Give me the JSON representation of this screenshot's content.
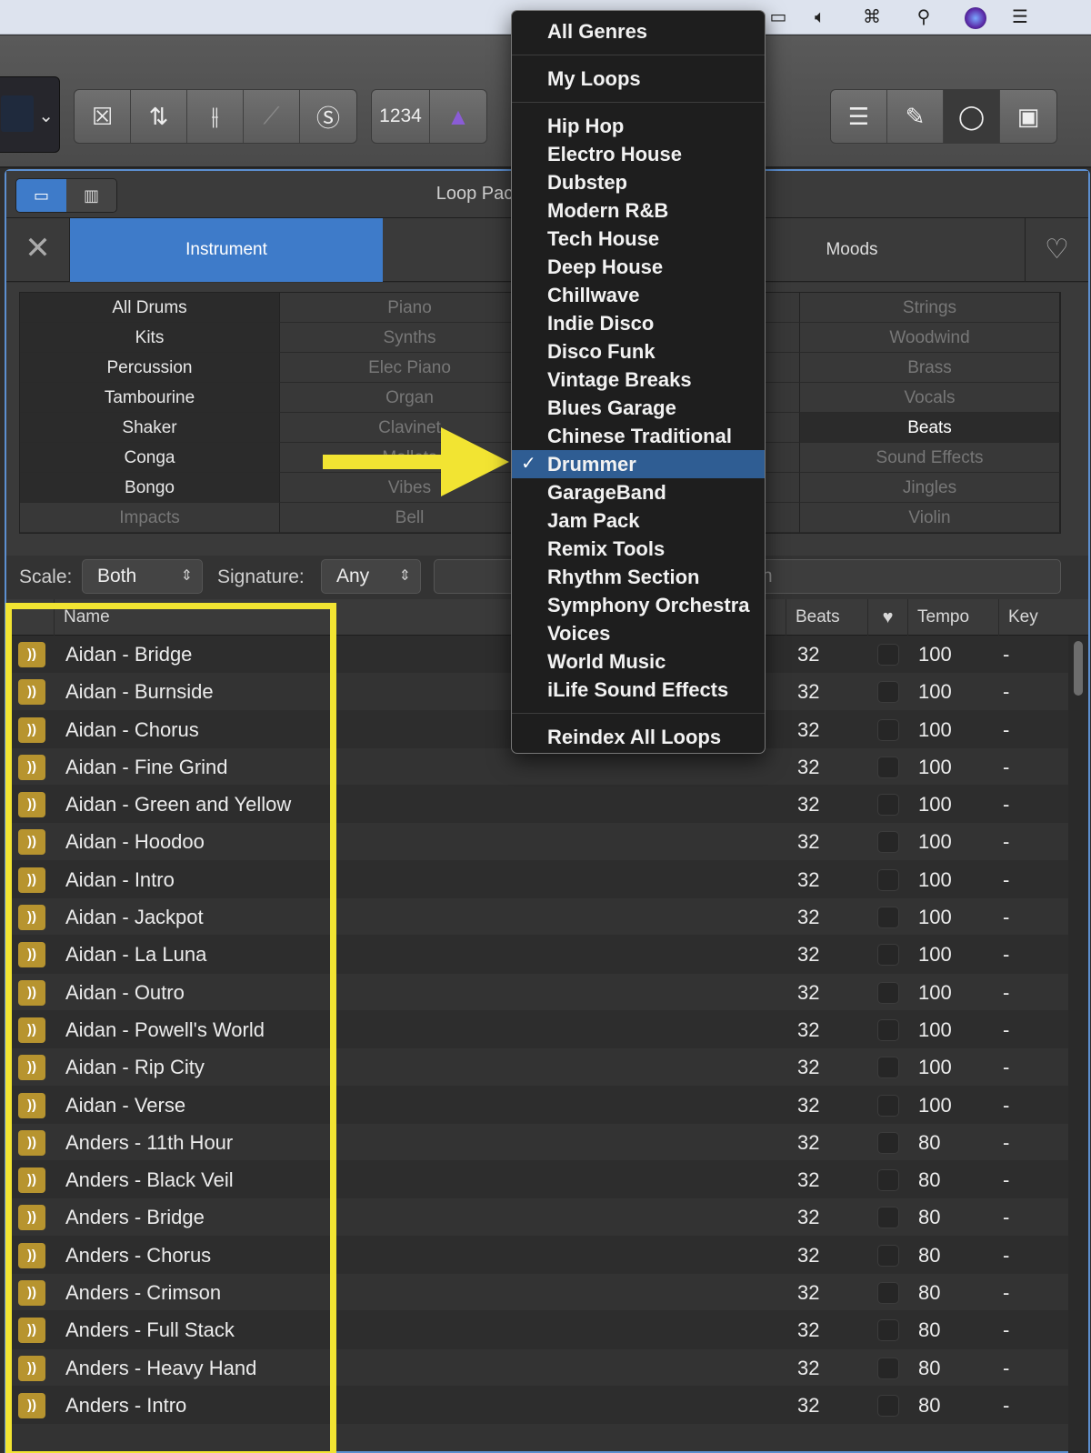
{
  "toolbar": {
    "lcd_chevron": "⌄",
    "count_in_label": "1234"
  },
  "browser": {
    "title": "Loop Pack",
    "view_buttons": [
      "loops-view",
      "columns-view"
    ]
  },
  "tabs": {
    "instrument": "Instrument",
    "moods": "Moods"
  },
  "tags": {
    "col1": [
      "All Drums",
      "Kits",
      "Percussion",
      "Tambourine",
      "Shaker",
      "Conga",
      "Bongo",
      "Impacts"
    ],
    "col2": [
      "Piano",
      "Synths",
      "Elec Piano",
      "Organ",
      "Clavinet",
      "Mallets",
      "Vibes",
      "Bell"
    ],
    "col4": [
      "Strings",
      "Woodwind",
      "Brass",
      "Vocals",
      "Beats",
      "Sound Effects",
      "Jingles",
      "Violin"
    ]
  },
  "filters": {
    "scale_label": "Scale:",
    "scale_value": "Both",
    "signature_label": "Signature:",
    "signature_value": "Any",
    "search_partial": "n"
  },
  "table": {
    "headers": {
      "name": "Name",
      "beats": "Beats",
      "tempo": "Tempo",
      "key": "Key"
    },
    "rows": [
      {
        "name": "Aidan - Bridge",
        "beats": "32",
        "tempo": "100",
        "key": "-"
      },
      {
        "name": "Aidan - Burnside",
        "beats": "32",
        "tempo": "100",
        "key": "-"
      },
      {
        "name": "Aidan - Chorus",
        "beats": "32",
        "tempo": "100",
        "key": "-"
      },
      {
        "name": "Aidan - Fine Grind",
        "beats": "32",
        "tempo": "100",
        "key": "-"
      },
      {
        "name": "Aidan - Green and Yellow",
        "beats": "32",
        "tempo": "100",
        "key": "-"
      },
      {
        "name": "Aidan - Hoodoo",
        "beats": "32",
        "tempo": "100",
        "key": "-"
      },
      {
        "name": "Aidan - Intro",
        "beats": "32",
        "tempo": "100",
        "key": "-"
      },
      {
        "name": "Aidan - Jackpot",
        "beats": "32",
        "tempo": "100",
        "key": "-"
      },
      {
        "name": "Aidan - La Luna",
        "beats": "32",
        "tempo": "100",
        "key": "-"
      },
      {
        "name": "Aidan - Outro",
        "beats": "32",
        "tempo": "100",
        "key": "-"
      },
      {
        "name": "Aidan - Powell's World",
        "beats": "32",
        "tempo": "100",
        "key": "-"
      },
      {
        "name": "Aidan - Rip City",
        "beats": "32",
        "tempo": "100",
        "key": "-"
      },
      {
        "name": "Aidan - Verse",
        "beats": "32",
        "tempo": "100",
        "key": "-"
      },
      {
        "name": "Anders - 11th Hour",
        "beats": "32",
        "tempo": "80",
        "key": "-"
      },
      {
        "name": "Anders - Black Veil",
        "beats": "32",
        "tempo": "80",
        "key": "-"
      },
      {
        "name": "Anders - Bridge",
        "beats": "32",
        "tempo": "80",
        "key": "-"
      },
      {
        "name": "Anders - Chorus",
        "beats": "32",
        "tempo": "80",
        "key": "-"
      },
      {
        "name": "Anders - Crimson",
        "beats": "32",
        "tempo": "80",
        "key": "-"
      },
      {
        "name": "Anders - Full Stack",
        "beats": "32",
        "tempo": "80",
        "key": "-"
      },
      {
        "name": "Anders - Heavy Hand",
        "beats": "32",
        "tempo": "80",
        "key": "-"
      },
      {
        "name": "Anders - Intro",
        "beats": "32",
        "tempo": "80",
        "key": "-"
      }
    ]
  },
  "menu": {
    "top": [
      "All Genres"
    ],
    "mine": [
      "My Loops"
    ],
    "genres": [
      "Hip Hop",
      "Electro House",
      "Dubstep",
      "Modern R&B",
      "Tech House",
      "Deep House",
      "Chillwave",
      "Indie Disco",
      "Disco Funk",
      "Vintage Breaks",
      "Blues Garage",
      "Chinese Traditional",
      "Drummer",
      "GarageBand",
      "Jam Pack",
      "Remix Tools",
      "Rhythm Section",
      "Symphony Orchestra",
      "Voices",
      "World Music",
      "iLife Sound Effects"
    ],
    "selected": "Drummer",
    "bottom": [
      "Reindex All Loops"
    ],
    "check": "✓"
  },
  "colors": {
    "highlight": "#f2e432",
    "accent": "#3e7bc9",
    "loop_icon": "#b7942f"
  }
}
